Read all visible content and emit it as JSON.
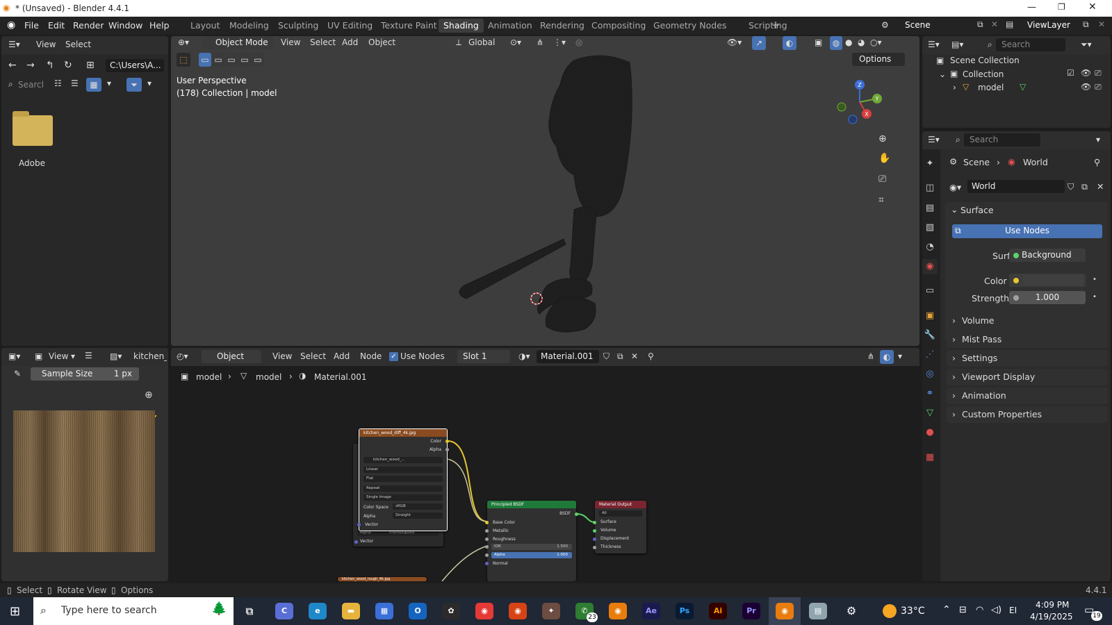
{
  "window": {
    "title": "* (Unsaved) - Blender 4.4.1"
  },
  "menu": [
    "File",
    "Edit",
    "Render",
    "Window",
    "Help"
  ],
  "workspaces": [
    "Layout",
    "Modeling",
    "Sculpting",
    "UV Editing",
    "Texture Paint",
    "Shading",
    "Animation",
    "Rendering",
    "Compositing",
    "Geometry Nodes",
    "Scripting"
  ],
  "active_workspace": "Shading",
  "topright": {
    "scene": "Scene",
    "viewlayer": "ViewLayer"
  },
  "filebrowser": {
    "view": "View",
    "select": "Select",
    "path": "C:\\Users\\A...",
    "search": "Search",
    "folder": "Adobe"
  },
  "viewport": {
    "mode": "Object Mode",
    "menus": [
      "View",
      "Select",
      "Add",
      "Object"
    ],
    "orientation": "Global",
    "options": "Options",
    "line1": "User Perspective",
    "line2": "(178) Collection | model",
    "gizmo": {
      "z": "Z",
      "y": "Y",
      "x": "X"
    }
  },
  "outliner": {
    "search": "Search",
    "scene_collection": "Scene Collection",
    "collection": "Collection",
    "model": "model"
  },
  "properties": {
    "search": "Search",
    "crumb_scene": "Scene",
    "crumb_world": "World",
    "world_name": "World",
    "surface_header": "Surface",
    "use_nodes": "Use Nodes",
    "surface_label": "Surface",
    "surface_value": "Background",
    "color_label": "Color",
    "strength_label": "Strength",
    "strength_value": "1.000",
    "sections": [
      "Volume",
      "Mist Pass",
      "Settings",
      "Viewport Display",
      "Animation",
      "Custom Properties"
    ]
  },
  "image_editor": {
    "view": "View",
    "image": "kitchen_v",
    "sample_label": "Sample Size",
    "sample_value": "1 px"
  },
  "node_editor": {
    "editor_type": "Object",
    "menus": [
      "View",
      "Select",
      "Add",
      "Node"
    ],
    "use_nodes": "Use Nodes",
    "slot": "Slot 1",
    "material": "Material.001",
    "crumbs": [
      "model",
      "model",
      "Material.001"
    ]
  },
  "nodes": {
    "image": {
      "title": "kitchen_wood_diff_4k.jpg",
      "out_color": "Color",
      "out_alpha": "Alpha",
      "image_name": "kitchen_wood_...",
      "interp": "Linear",
      "proj": "Flat",
      "ext": "Repeat",
      "source": "Single Image",
      "cs_label": "Color Space",
      "cs_value": "sRGB",
      "alpha_label": "Alpha",
      "alpha_value": "Straight",
      "vector": "Vector"
    },
    "behind": {
      "alpha_label": "Alpha",
      "alpha_value": "Premultiplied",
      "vector": "Vector"
    },
    "bsdf": {
      "title": "Principled BSDF",
      "out": "BSDF",
      "base": "Base Color",
      "metallic": "Metallic",
      "rough": "Roughness",
      "ior_label": "IOR",
      "ior_value": "1.500",
      "alpha_label": "Alpha",
      "alpha_value": "1.000",
      "normal": "Normal"
    },
    "output": {
      "title": "Material Output",
      "target": "All",
      "surface": "Surface",
      "volume": "Volume",
      "disp": "Displacement",
      "thick": "Thickness"
    },
    "bottom": {
      "title": "kitchen_wood_rough_4k.jpg"
    }
  },
  "status": {
    "select": "Select",
    "rotate": "Rotate View",
    "options": "Options",
    "version": "4.4.1"
  },
  "taskbar": {
    "search": "Type here to search",
    "temp": "33°C",
    "time": "4:09 PM",
    "date": "4/19/2025",
    "lang": "ENG",
    "badge_whatsapp": "23",
    "badge_notif": "19"
  }
}
